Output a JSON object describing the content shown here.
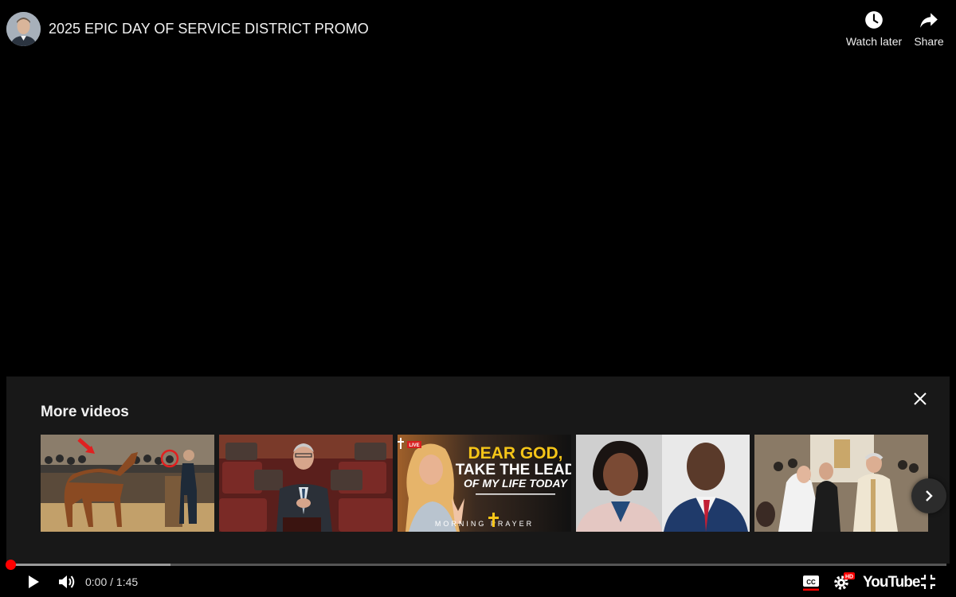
{
  "header": {
    "title": "2025 EPIC DAY OF SERVICE DISTRICT PROMO",
    "watch_later_label": "Watch later",
    "share_label": "Share"
  },
  "more_videos": {
    "title": "More videos",
    "thumbnails": [
      {
        "name": "horse-auction-thumbnail",
        "overlay_text": ""
      },
      {
        "name": "senate-speech-thumbnail",
        "overlay_text": ""
      },
      {
        "name": "morning-prayer-thumbnail",
        "line1": "DEAR GOD,",
        "line2": "TAKE THE LEAD",
        "line3": "OF MY LIFE TODAY",
        "footer": "MORNING PRAYER",
        "badge": "LIVE"
      },
      {
        "name": "interview-thumbnail",
        "overlay_text": ""
      },
      {
        "name": "wedding-thumbnail",
        "overlay_text": ""
      }
    ]
  },
  "player": {
    "current_time": "0:00",
    "separator": " / ",
    "duration": "1:45",
    "time_display": "0:00 / 1:45",
    "loaded_fraction": 0.172,
    "played_fraction": 0.0,
    "brand": "YouTube",
    "hd_badge": "HD"
  },
  "colors": {
    "accent": "#ff0000",
    "panel_bg": "#181818",
    "prayer_yellow": "#f5c518"
  }
}
